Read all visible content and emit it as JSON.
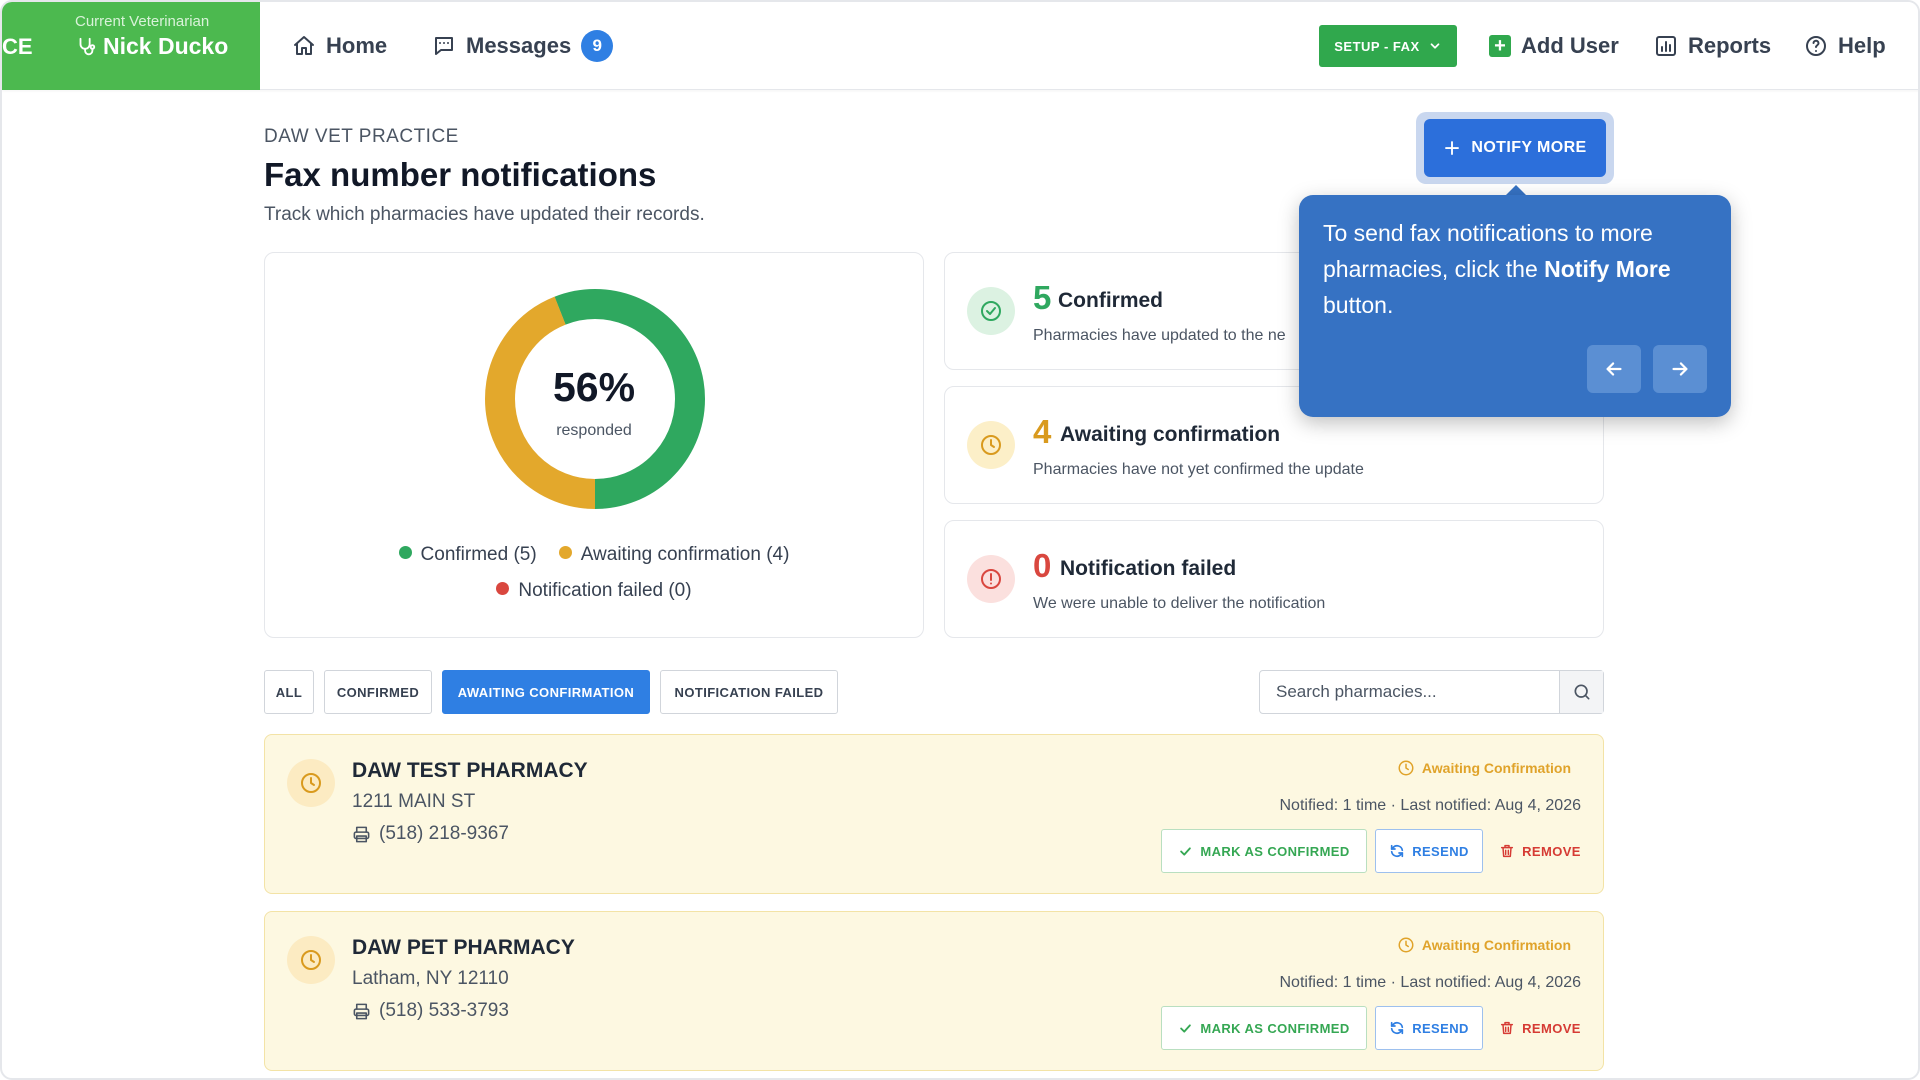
{
  "header": {
    "brand_cut": "CE",
    "brand_sub": "Current Veterinarian",
    "vet_name": "Nick Ducko",
    "nav_home": "Home",
    "nav_messages": "Messages",
    "messages_count": "9",
    "setup_label": "SETUP - FAX",
    "add_user": "Add User",
    "reports": "Reports",
    "help": "Help",
    "brand_color": "#4cb94f"
  },
  "page": {
    "practice": "DAW VET PRACTICE",
    "title": "Fax number notifications",
    "subtitle": "Track which pharmacies have updated their records.",
    "notify_more": "NOTIFY MORE"
  },
  "summary": {
    "percent": "56%",
    "percent_value": 56,
    "percent_label": "responded",
    "legend_confirmed": "Confirmed (5)",
    "legend_awaiting": "Awaiting confirmation (4)",
    "legend_failed": "Notification failed (0)",
    "colors": {
      "confirmed": "#2fa85f",
      "awaiting": "#e3a82c",
      "failed": "#d9473f"
    }
  },
  "stats": {
    "confirmed": {
      "num": "5",
      "label": "Confirmed",
      "desc": "Pharmacies have updated to the ne"
    },
    "awaiting": {
      "num": "4",
      "label": "Awaiting confirmation",
      "desc": "Pharmacies have not yet confirmed the update"
    },
    "failed": {
      "num": "0",
      "label": "Notification failed",
      "desc": "We were unable to deliver the notification"
    }
  },
  "tooltip": {
    "text_before": "To send fax notifications to more pharmacies, click the ",
    "text_bold": "Notify More",
    "text_after": " button."
  },
  "filters": {
    "all": "ALL",
    "confirmed": "CONFIRMED",
    "awaiting": "AWAITING CONFIRMATION",
    "failed": "NOTIFICATION FAILED",
    "active": "awaiting"
  },
  "search": {
    "placeholder": "Search pharmacies..."
  },
  "pharmacies": [
    {
      "name": "DAW TEST PHARMACY",
      "address": "1211 MAIN ST",
      "fax": "(518) 218-9367",
      "status": "Awaiting Confirmation",
      "meta": "Notified: 1 time · Last notified: Aug 4, 2026",
      "confirm_label": "MARK AS CONFIRMED",
      "resend_label": "RESEND",
      "remove_label": "REMOVE"
    },
    {
      "name": "DAW PET PHARMACY",
      "address": "Latham, NY 12110",
      "fax": "(518) 533-3793",
      "status": "Awaiting Confirmation",
      "meta": "Notified: 1 time · Last notified: Aug 4, 2026",
      "confirm_label": "MARK AS CONFIRMED",
      "resend_label": "RESEND",
      "remove_label": "REMOVE"
    }
  ]
}
